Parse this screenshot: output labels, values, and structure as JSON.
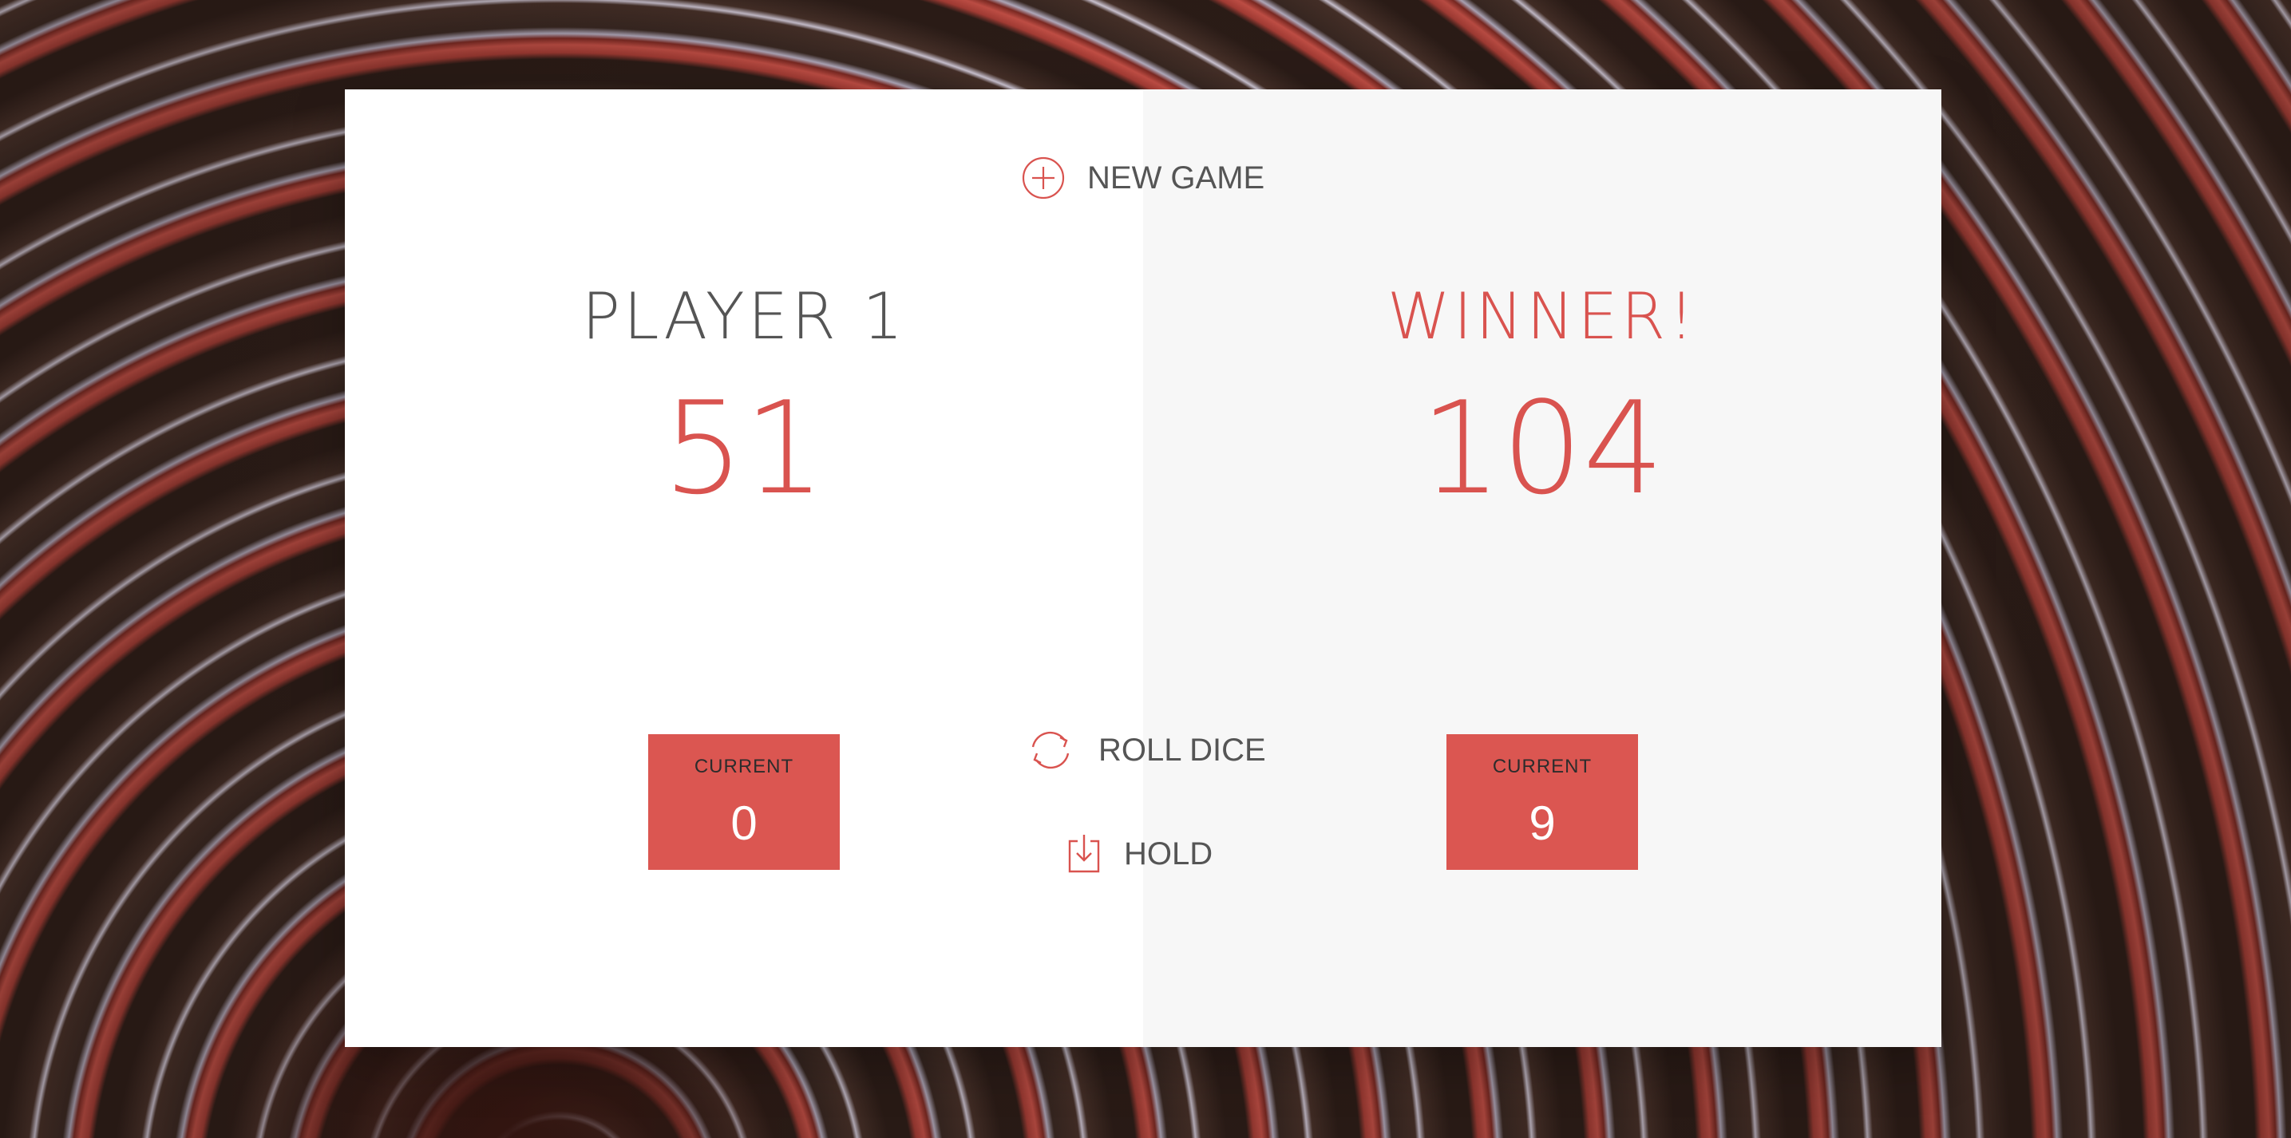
{
  "actions": {
    "new_game": "NEW GAME",
    "roll_dice": "ROLL DICE",
    "hold": "HOLD"
  },
  "players": [
    {
      "name": "PLAYER 1",
      "score": "51",
      "current_label": "CURRENT",
      "current_value": "0",
      "active": false
    },
    {
      "name": "WINNER!",
      "score": "104",
      "current_label": "CURRENT",
      "current_value": "9",
      "winner": true
    }
  ],
  "icons": {
    "new_game": "add-circle-icon",
    "roll_dice": "refresh-icon",
    "hold": "download-icon"
  },
  "colors": {
    "accent": "#d9534f",
    "text": "#555555",
    "panel_left": "#ffffff",
    "panel_right": "#f7f7f7"
  }
}
